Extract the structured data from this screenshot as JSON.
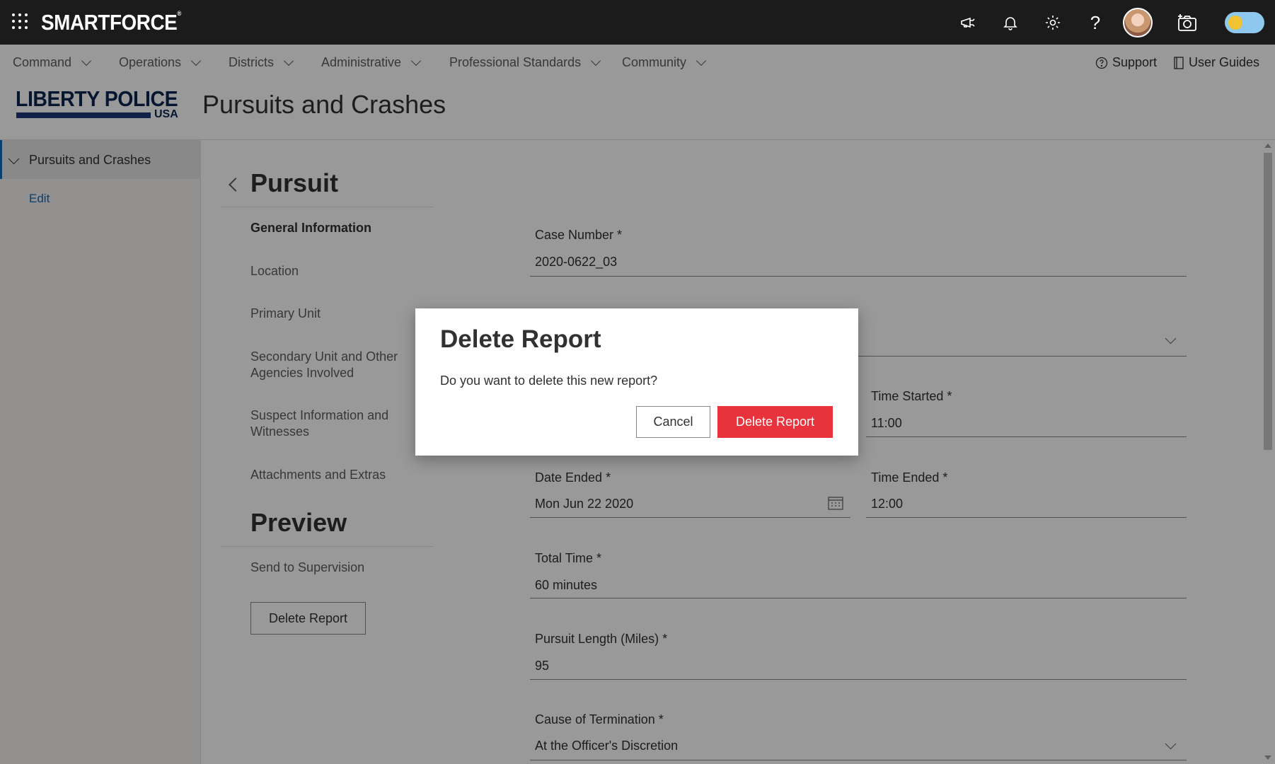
{
  "topbar": {
    "brand": "SMARTFORCE",
    "brand_mark": "®",
    "icons": [
      "waffle-icon",
      "megaphone-icon",
      "bell-icon",
      "gear-icon",
      "help-icon",
      "avatar",
      "camera-icon",
      "theme-toggle"
    ]
  },
  "nav": {
    "items": [
      "Command",
      "Operations",
      "Districts",
      "Administrative",
      "Professional Standards",
      "Community"
    ],
    "support": "Support",
    "user_guides": "User Guides"
  },
  "header": {
    "logo_text": "LIBERTY POLICE",
    "logo_sub": "USA",
    "page_title": "Pursuits and Crashes"
  },
  "sidebar": {
    "section": "Pursuits and Crashes",
    "edit": "Edit"
  },
  "mid": {
    "heading": "Pursuit",
    "items": [
      "General Information",
      "Location",
      "Primary Unit",
      "Secondary Unit and Other Agencies Involved",
      "Suspect Information and Witnesses",
      "Attachments and Extras"
    ],
    "preview_heading": "Preview",
    "send": "Send to Supervision",
    "delete_button": "Delete Report"
  },
  "form": {
    "case_number_label": "Case Number *",
    "case_number_value": "2020-0622_03",
    "time_started_label": "Time Started *",
    "time_started_value": "11:00",
    "date_ended_label": "Date Ended *",
    "date_ended_value": "Mon Jun 22 2020",
    "time_ended_label": "Time Ended *",
    "time_ended_value": "12:00",
    "total_time_label": "Total Time *",
    "total_time_value": "60 minutes",
    "pursuit_length_label": "Pursuit Length (Miles) *",
    "pursuit_length_value": "95",
    "cause_label": "Cause of Termination *",
    "cause_value": "At the Officer's Discretion"
  },
  "dialog": {
    "title": "Delete Report",
    "message": "Do you want to delete this new report?",
    "cancel": "Cancel",
    "confirm": "Delete Report"
  },
  "colors": {
    "topbar": "#1b1b1b",
    "accent": "#0f6cbd",
    "danger": "#e8323c",
    "logo": "#0d2650"
  }
}
